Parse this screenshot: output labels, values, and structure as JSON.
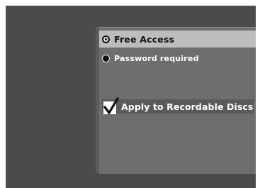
{
  "access_options": [
    {
      "label": "Free Access",
      "selected": true
    },
    {
      "label": "Password required",
      "selected": false
    }
  ],
  "apply_option": {
    "label": "Apply to Recordable Discs",
    "checked": true
  },
  "colors": {
    "background": "#4b4b4b",
    "panel": "#6e6e6e",
    "highlight": "#bdbdbd",
    "text": "#ffffff"
  }
}
